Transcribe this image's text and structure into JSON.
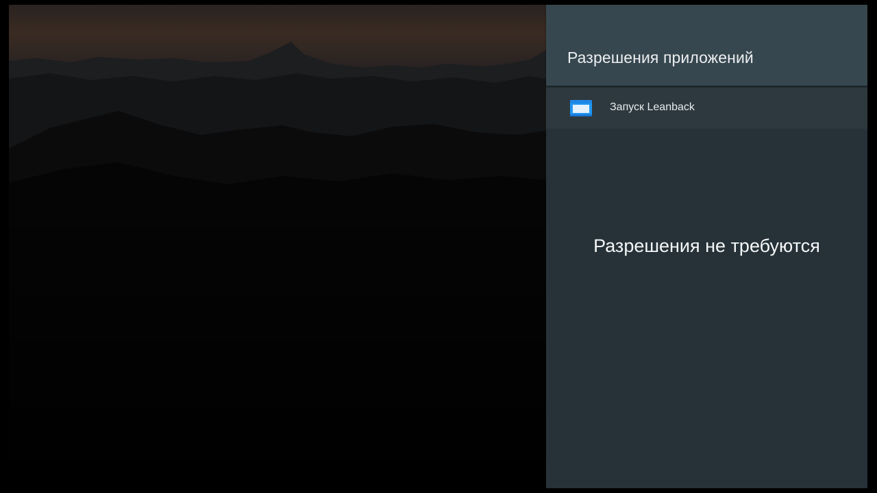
{
  "panel": {
    "title": "Разрешения приложений",
    "header_color": "#37474f",
    "body_color": "#263238"
  },
  "permission_list": {
    "items": [
      {
        "label": "Запуск Leanback",
        "icon": "app-window-icon"
      }
    ]
  },
  "empty_state": {
    "message": "Разрешения не требуются"
  },
  "background": {
    "description_icon": "mountain-wallpaper",
    "sky_color": "#3a2a22"
  }
}
